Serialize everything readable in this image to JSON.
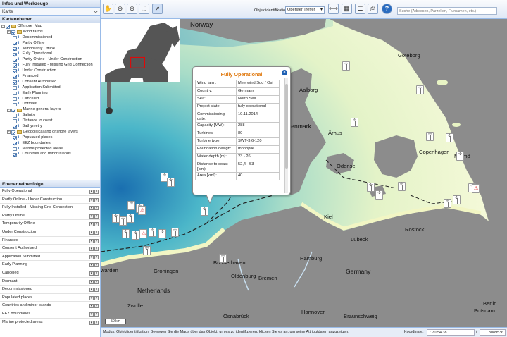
{
  "left_panel": {
    "info_header": "Infos und Werkzeuge",
    "map_select": "Karte",
    "layers_header": "Kartenebenen",
    "order_header": "Ebenenreihenfolge"
  },
  "tree": [
    {
      "label": "Offshore_Map",
      "level": 0,
      "type": "folder",
      "checked": true
    },
    {
      "label": "Wind farms",
      "level": 1,
      "type": "folder",
      "checked": true
    },
    {
      "label": "Decommissioned",
      "level": 2,
      "checked": false
    },
    {
      "label": "Partly Offline",
      "level": 2,
      "checked": true
    },
    {
      "label": "Temporarily Offline",
      "level": 2,
      "checked": true
    },
    {
      "label": "Fully Operational",
      "level": 2,
      "checked": true
    },
    {
      "label": "Partly Online - Under Construction",
      "level": 2,
      "checked": true
    },
    {
      "label": "Fully Installed - Missing Grid Connection",
      "level": 2,
      "checked": true
    },
    {
      "label": "Under Construction",
      "level": 2,
      "checked": true
    },
    {
      "label": "Financed",
      "level": 2,
      "checked": true
    },
    {
      "label": "Consent Authorised",
      "level": 2,
      "checked": true
    },
    {
      "label": "Application Submitted",
      "level": 2,
      "checked": false
    },
    {
      "label": "Early Planning",
      "level": 2,
      "checked": false
    },
    {
      "label": "Canceled",
      "level": 2,
      "checked": false
    },
    {
      "label": "Dormant",
      "level": 2,
      "checked": false
    },
    {
      "label": "Marine general layers",
      "level": 1,
      "type": "folder",
      "checked": true
    },
    {
      "label": "Salinity",
      "level": 2,
      "checked": false
    },
    {
      "label": "Distance to coast",
      "level": 2,
      "checked": false
    },
    {
      "label": "Bathymetry",
      "level": 2,
      "checked": true
    },
    {
      "label": "Geopolitical and onshore layers",
      "level": 1,
      "type": "folder",
      "checked": true
    },
    {
      "label": "Populated places",
      "level": 2,
      "checked": true
    },
    {
      "label": "EEZ boundaries",
      "level": 2,
      "checked": true
    },
    {
      "label": "Marine protected areas",
      "level": 2,
      "checked": false
    },
    {
      "label": "Countries and minor islands",
      "level": 2,
      "checked": true
    }
  ],
  "order": [
    "Fully Operational",
    "Partly Online - Under Construction",
    "Fully Installed - Missing Grid Connection",
    "Partly Offline",
    "Temporarily Offline",
    "Under Construction",
    "Financed",
    "Consent Authorised",
    "Application Submitted",
    "Early Planning",
    "Canceled",
    "Dormant",
    "Decommissioned",
    "Populated places",
    "Countries and minor islands",
    "EEZ boundaries",
    "Marine protected areas"
  ],
  "toolbar": {
    "obj_label": "Objektidentifikation:",
    "obj_value": "Oberster Treffer",
    "search_placeholder": "Suche (Adressen, Parzellen, Flurnamen, etc.)",
    "help": "?"
  },
  "map_labels": {
    "norway": "Norway",
    "goteborg": "Göteborg",
    "aalborg": "Aalborg",
    "denmark": "Denmark",
    "arhus": "Århus",
    "copenhagen": "Copenhagen",
    "malmo": "Malmö",
    "odense": "Odense",
    "kiel": "Kiel",
    "rostock": "Rostock",
    "lubeck": "Lubeck",
    "hamburg": "Hamburg",
    "bremerhaven": "Bremerhaven",
    "oldenburg": "Oldenburg",
    "bremen": "Bremen",
    "germany": "Germany",
    "groningen": "Groningen",
    "leeuwarden": "warden",
    "netherlands": "Netherlands",
    "zwolle": "Zwolle",
    "hannover": "Hannover",
    "osnabruck": "Osnabrück",
    "braunschweig": "Braunschweig",
    "berlin": "Berlin",
    "potsdam": "Potsdam"
  },
  "popup": {
    "title": "Fully Operational",
    "rows": [
      {
        "k": "Wind farm:",
        "v": "Meerwind Sud / Ost"
      },
      {
        "k": "Country:",
        "v": "Germany"
      },
      {
        "k": "Sea:",
        "v": "North Sea"
      },
      {
        "k": "Project state:",
        "v": "fully operational"
      },
      {
        "k": "Commissioning date:",
        "v": "10.11.2014"
      },
      {
        "k": "Capacity [MW]:",
        "v": "288"
      },
      {
        "k": "Turbines:",
        "v": "80"
      },
      {
        "k": "Turbine type:",
        "v": "SWT-3,6-120"
      },
      {
        "k": "Foundation design:",
        "v": "monopile"
      },
      {
        "k": "Water depth [m]:",
        "v": "23 - 26"
      },
      {
        "k": "Distance to coast [km]:",
        "v": "52,4 - 53"
      },
      {
        "k": "Area [km²]:",
        "v": "40"
      }
    ]
  },
  "scalebar": "50 km",
  "status": {
    "text": "Modus: Objektidentifikation. Bewegen Sie die Maus über das Objekt, um es zu identifizieren, klicken Sie es an, um seine Attributdaten anzuzeigen.",
    "coord_label": "Koordinate:",
    "coord_x": "7.70,54.38",
    "coord_sep": "/",
    "coord_y": "3089536"
  }
}
